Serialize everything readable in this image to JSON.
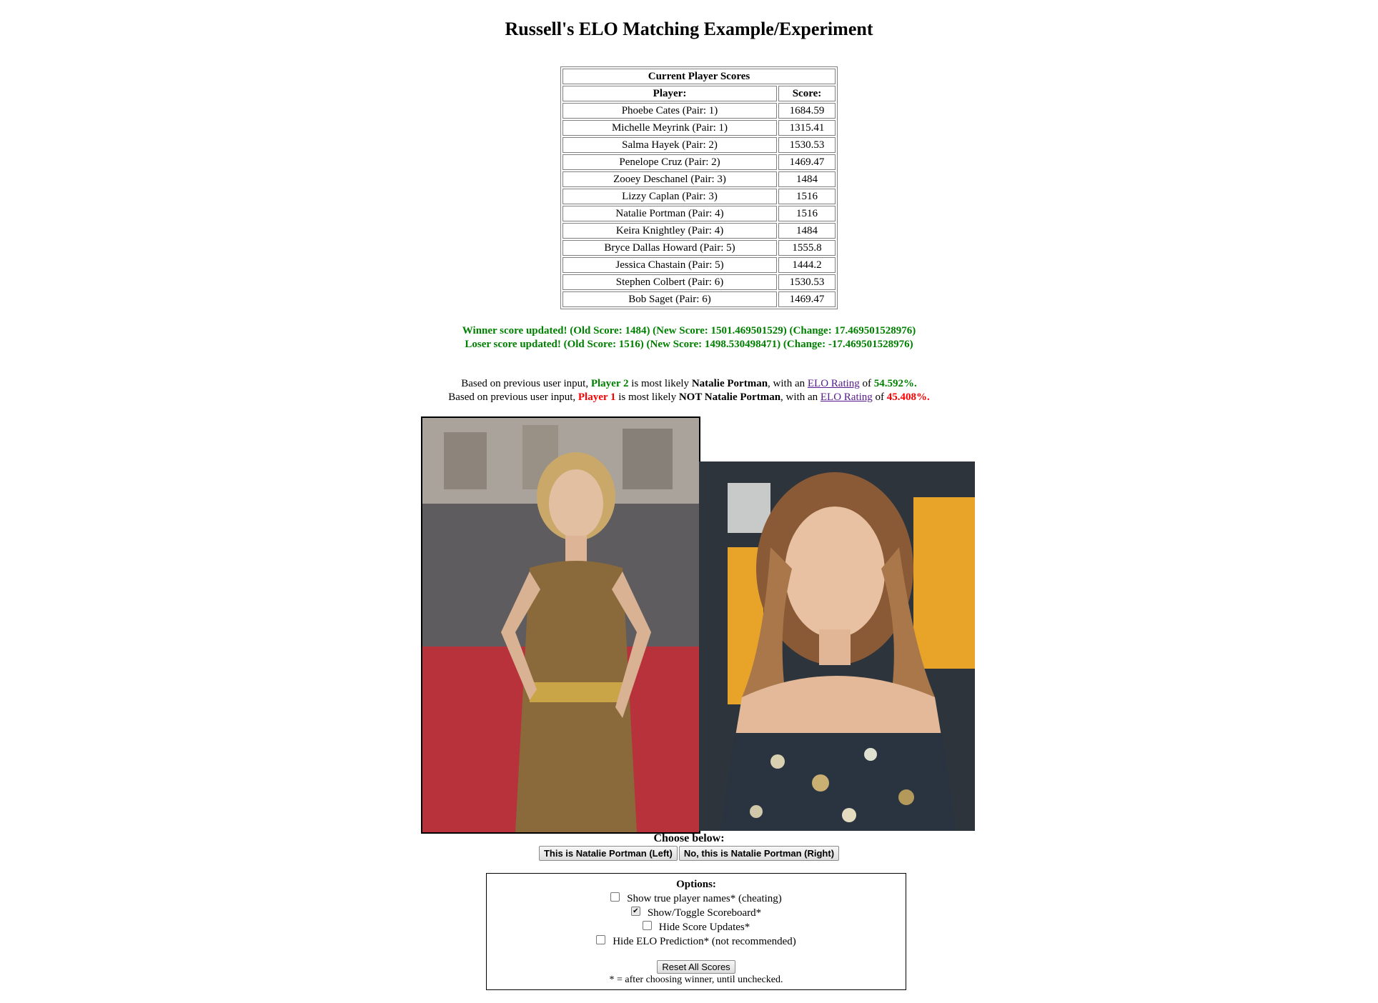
{
  "page": {
    "title": "Russell's ELO Matching Example/Experiment"
  },
  "scoreboard": {
    "caption": "Current Player Scores",
    "col_player": "Player:",
    "col_score": "Score:",
    "rows": [
      {
        "player": "Phoebe Cates (Pair: 1)",
        "score": "1684.59"
      },
      {
        "player": "Michelle Meyrink (Pair: 1)",
        "score": "1315.41"
      },
      {
        "player": "Salma Hayek (Pair: 2)",
        "score": "1530.53"
      },
      {
        "player": "Penelope Cruz (Pair: 2)",
        "score": "1469.47"
      },
      {
        "player": "Zooey Deschanel (Pair: 3)",
        "score": "1484"
      },
      {
        "player": "Lizzy Caplan (Pair: 3)",
        "score": "1516"
      },
      {
        "player": "Natalie Portman (Pair: 4)",
        "score": "1516"
      },
      {
        "player": "Keira Knightley (Pair: 4)",
        "score": "1484"
      },
      {
        "player": "Bryce Dallas Howard (Pair: 5)",
        "score": "1555.8"
      },
      {
        "player": "Jessica Chastain (Pair: 5)",
        "score": "1444.2"
      },
      {
        "player": "Stephen Colbert (Pair: 6)",
        "score": "1530.53"
      },
      {
        "player": "Bob Saget (Pair: 6)",
        "score": "1469.47"
      }
    ]
  },
  "updates": {
    "winner": "Winner score updated! (Old Score: 1484) (New Score: 1501.469501529) (Change: 17.469501528976)",
    "loser": "Loser score updated! (Old Score: 1516) (New Score: 1498.530498471) (Change: -17.469501528976)"
  },
  "prediction": {
    "line1": {
      "prefix": "Based on previous user input, ",
      "player": "Player 2",
      "middle": " is most likely ",
      "name": "Natalie Portman",
      "after_name": ", with an ",
      "link": "ELO Rating",
      "of": " of ",
      "percent": "54.592%."
    },
    "line2": {
      "prefix": "Based on previous user input, ",
      "player": "Player 1",
      "middle": " is most likely ",
      "name": "NOT Natalie Portman",
      "after_name": ", with an ",
      "link": "ELO Rating",
      "of": " of ",
      "percent": "45.408%."
    }
  },
  "choose": {
    "label": "Choose below:",
    "left_button": "This is Natalie Portman (Left)",
    "right_button": "No, this is Natalie Portman (Right)"
  },
  "options": {
    "title": "Options:",
    "items": [
      {
        "label": "Show true player names* (cheating)",
        "checked": false
      },
      {
        "label": "Show/Toggle Scoreboard*",
        "checked": true
      },
      {
        "label": "Hide Score Updates*",
        "checked": false
      },
      {
        "label": "Hide ELO Prediction* (not recommended)",
        "checked": false
      }
    ],
    "reset_button": "Reset All Scores",
    "footnote": "* = after choosing winner, until unchecked."
  },
  "colors": {
    "green": "#008000",
    "red": "#ff0000",
    "link": "#551a8b"
  }
}
